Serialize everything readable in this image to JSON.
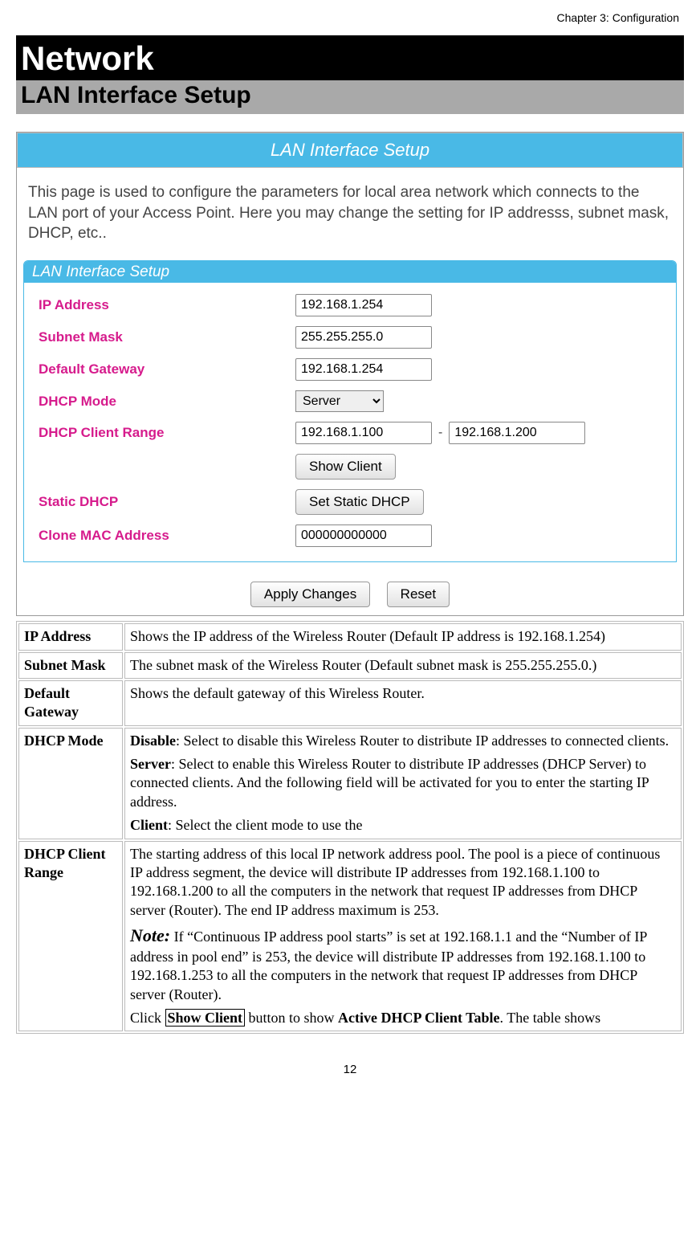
{
  "header": {
    "chapter": "Chapter 3: Configuration"
  },
  "section": {
    "title": "Network",
    "subtitle": "LAN Interface Setup"
  },
  "screenshot": {
    "bar_title": "LAN Interface Setup",
    "intro": "This page is used to configure the parameters for local area network which connects to the LAN port of your Access Point. Here you may change the setting for IP addresss, subnet mask, DHCP, etc..",
    "panel_title": "LAN Interface Setup",
    "labels": {
      "ip": "IP Address",
      "mask": "Subnet Mask",
      "gw": "Default Gateway",
      "mode": "DHCP Mode",
      "range": "DHCP Client Range",
      "static": "Static DHCP",
      "clone": "Clone MAC Address"
    },
    "values": {
      "ip": "192.168.1.254",
      "mask": "255.255.255.0",
      "gw": "192.168.1.254",
      "mode": "Server",
      "range_start": "192.168.1.100",
      "range_end": "192.168.1.200",
      "range_sep": "-",
      "clone": "000000000000"
    },
    "buttons": {
      "show_client": "Show Client",
      "set_static": "Set Static DHCP",
      "apply": "Apply Changes",
      "reset": "Reset"
    }
  },
  "defs": {
    "ip": {
      "key": "IP Address",
      "text": "Shows the IP address of the Wireless Router (Default IP address is 192.168.1.254)"
    },
    "mask": {
      "key": "Subnet Mask",
      "text": "The subnet mask of the Wireless Router (Default subnet mask is 255.255.255.0.)"
    },
    "gw": {
      "key": "Default Gateway",
      "text": "Shows the default gateway of this Wireless Router."
    },
    "mode": {
      "key": "DHCP Mode",
      "disable_b": "Disable",
      "disable_t": ": Select to disable this Wireless Router to distribute IP addresses to connected clients.",
      "server_b": "Server",
      "server_t": ": Select to enable this Wireless Router to distribute IP addresses (DHCP Server) to connected clients. And the following field will be activated for you to enter the starting IP address.",
      "client_b": "Client",
      "client_t": ": Select the client mode to use the"
    },
    "range": {
      "key": "DHCP Client Range",
      "p1": "The starting address of this local IP network address pool. The pool is a piece of continuous IP address segment, the device will distribute IP addresses from 192.168.1.100 to 192.168.1.200 to all the computers in the network that request IP addresses from DHCP server (Router). The end IP address maximum is  253.",
      "note_label": "Note:",
      "note_text": "  If “Continuous IP address pool starts” is set at 192.168.1.1 and the “Number of IP address in pool end” is 253, the device will distribute IP addresses from 192.168.1.100 to 192.168.1.253 to all the computers in the network that request IP addresses from DHCP server (Router).",
      "p3_a": "Click ",
      "p3_box": "Show Client",
      "p3_b": " button to show ",
      "p3_bold": "Active DHCP Client Table",
      "p3_c": ". The table shows"
    }
  },
  "page_number": "12"
}
